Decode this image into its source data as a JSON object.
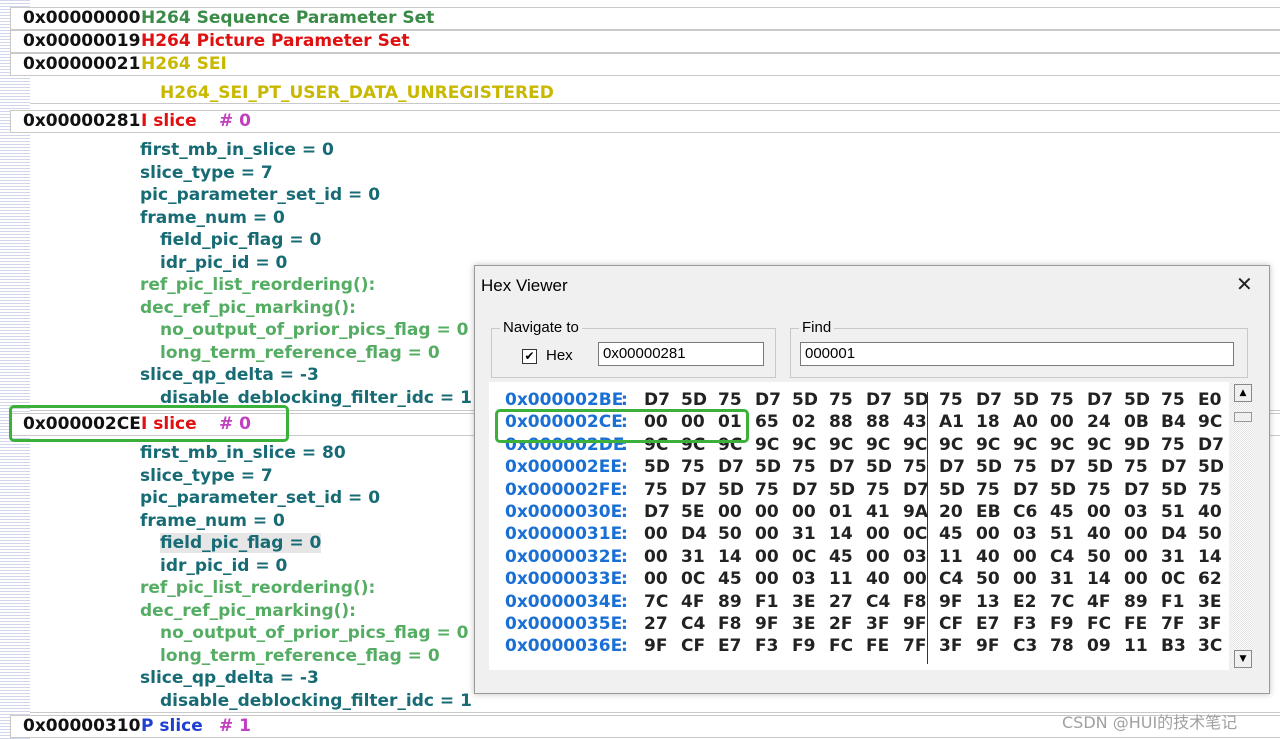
{
  "nal_units": [
    {
      "addr": "0x00000000",
      "name": "H264 Sequence Parameter Set",
      "name_color": "#3a8a48",
      "index": "",
      "index_color": ""
    },
    {
      "addr": "0x00000019",
      "name": "H264 Picture Parameter Set",
      "name_color": "#e01010",
      "index": "",
      "index_color": ""
    },
    {
      "addr": "0x00000021",
      "name": "H264 SEI",
      "name_color": "#c8b800",
      "index": "",
      "index_color": ""
    },
    {
      "addr": "0x00000281",
      "name": "I  slice",
      "name_color": "#e01010",
      "index": "# 0",
      "index_color": "#c040c0"
    },
    {
      "addr": "0x000002CE",
      "name": "I  slice",
      "name_color": "#e01010",
      "index": "# 0",
      "index_color": "#c040c0"
    },
    {
      "addr": "0x00000310",
      "name": "P slice",
      "name_color": "#1f3fd0",
      "index": "# 1",
      "index_color": "#c040c0"
    }
  ],
  "sei_detail": "H264_SEI_PT_USER_DATA_UNREGISTERED",
  "slice_fields": [
    [
      {
        "text": "first_mb_in_slice = 0",
        "color": "teal",
        "indent": 0
      },
      {
        "text": "slice_type = 7",
        "color": "teal",
        "indent": 0
      },
      {
        "text": "pic_parameter_set_id = 0",
        "color": "teal",
        "indent": 0
      },
      {
        "text": "frame_num = 0",
        "color": "teal",
        "indent": 0
      },
      {
        "text": "field_pic_flag = 0",
        "color": "teal",
        "indent": 1
      },
      {
        "text": "idr_pic_id = 0",
        "color": "teal",
        "indent": 1
      },
      {
        "text": "ref_pic_list_reordering():",
        "color": "green",
        "indent": 0
      },
      {
        "text": "dec_ref_pic_marking():",
        "color": "green",
        "indent": 0
      },
      {
        "text": "no_output_of_prior_pics_flag = 0",
        "color": "green",
        "indent": 1
      },
      {
        "text": "long_term_reference_flag = 0",
        "color": "green",
        "indent": 1
      },
      {
        "text": "slice_qp_delta = -3",
        "color": "teal",
        "indent": 0
      },
      {
        "text": "disable_deblocking_filter_idc = 1",
        "color": "teal",
        "indent": 1
      }
    ],
    [
      {
        "text": "first_mb_in_slice = 80",
        "color": "teal",
        "indent": 0
      },
      {
        "text": "slice_type = 7",
        "color": "teal",
        "indent": 0
      },
      {
        "text": "pic_parameter_set_id = 0",
        "color": "teal",
        "indent": 0
      },
      {
        "text": "frame_num = 0",
        "color": "teal",
        "indent": 0
      },
      {
        "text": "field_pic_flag = 0",
        "color": "teal",
        "indent": 1,
        "selected": true
      },
      {
        "text": "idr_pic_id = 0",
        "color": "teal",
        "indent": 1
      },
      {
        "text": "ref_pic_list_reordering():",
        "color": "green",
        "indent": 0
      },
      {
        "text": "dec_ref_pic_marking():",
        "color": "green",
        "indent": 0
      },
      {
        "text": "no_output_of_prior_pics_flag = 0",
        "color": "green",
        "indent": 1
      },
      {
        "text": "long_term_reference_flag = 0",
        "color": "green",
        "indent": 1
      },
      {
        "text": "slice_qp_delta = -3",
        "color": "teal",
        "indent": 0
      },
      {
        "text": "disable_deblocking_filter_idc = 1",
        "color": "teal",
        "indent": 1
      }
    ]
  ],
  "hex_viewer": {
    "title": "Hex Viewer",
    "close_icon": "close-icon",
    "navigate": {
      "legend": "Navigate to",
      "hex_label": "Hex",
      "hex_checked": true,
      "value": "0x00000281"
    },
    "find": {
      "legend": "Find",
      "value": "000001"
    },
    "rows": [
      {
        "addr": "0x000002BE",
        "bytes": [
          "D7",
          "5D",
          "75",
          "D7",
          "5D",
          "75",
          "D7",
          "5D",
          "75",
          "D7",
          "5D",
          "75",
          "D7",
          "5D",
          "75",
          "E0"
        ]
      },
      {
        "addr": "0x000002CE",
        "bytes": [
          "00",
          "00",
          "01",
          "65",
          "02",
          "88",
          "88",
          "43",
          "A1",
          "18",
          "A0",
          "00",
          "24",
          "0B",
          "B4",
          "9C"
        ]
      },
      {
        "addr": "0x000002DE",
        "bytes": [
          "9C",
          "9C",
          "9C",
          "9C",
          "9C",
          "9C",
          "9C",
          "9C",
          "9C",
          "9C",
          "9C",
          "9C",
          "9C",
          "9D",
          "75",
          "D7"
        ]
      },
      {
        "addr": "0x000002EE",
        "bytes": [
          "5D",
          "75",
          "D7",
          "5D",
          "75",
          "D7",
          "5D",
          "75",
          "D7",
          "5D",
          "75",
          "D7",
          "5D",
          "75",
          "D7",
          "5D"
        ]
      },
      {
        "addr": "0x000002FE",
        "bytes": [
          "75",
          "D7",
          "5D",
          "75",
          "D7",
          "5D",
          "75",
          "D7",
          "5D",
          "75",
          "D7",
          "5D",
          "75",
          "D7",
          "5D",
          "75"
        ]
      },
      {
        "addr": "0x0000030E",
        "bytes": [
          "D7",
          "5E",
          "00",
          "00",
          "00",
          "01",
          "41",
          "9A",
          "20",
          "EB",
          "C6",
          "45",
          "00",
          "03",
          "51",
          "40"
        ]
      },
      {
        "addr": "0x0000031E",
        "bytes": [
          "00",
          "D4",
          "50",
          "00",
          "31",
          "14",
          "00",
          "0C",
          "45",
          "00",
          "03",
          "51",
          "40",
          "00",
          "D4",
          "50"
        ]
      },
      {
        "addr": "0x0000032E",
        "bytes": [
          "00",
          "31",
          "14",
          "00",
          "0C",
          "45",
          "00",
          "03",
          "11",
          "40",
          "00",
          "C4",
          "50",
          "00",
          "31",
          "14"
        ]
      },
      {
        "addr": "0x0000033E",
        "bytes": [
          "00",
          "0C",
          "45",
          "00",
          "03",
          "11",
          "40",
          "00",
          "C4",
          "50",
          "00",
          "31",
          "14",
          "00",
          "0C",
          "62"
        ]
      },
      {
        "addr": "0x0000034E",
        "bytes": [
          "7C",
          "4F",
          "89",
          "F1",
          "3E",
          "27",
          "C4",
          "F8",
          "9F",
          "13",
          "E2",
          "7C",
          "4F",
          "89",
          "F1",
          "3E"
        ]
      },
      {
        "addr": "0x0000035E",
        "bytes": [
          "27",
          "C4",
          "F8",
          "9F",
          "3E",
          "2F",
          "3F",
          "9F",
          "CF",
          "E7",
          "F3",
          "F9",
          "FC",
          "FE",
          "7F",
          "3F"
        ]
      },
      {
        "addr": "0x0000036E",
        "bytes": [
          "9F",
          "CF",
          "E7",
          "F3",
          "F9",
          "FC",
          "FE",
          "7F",
          "3F",
          "9F",
          "C3",
          "78",
          "09",
          "11",
          "B3",
          "3C"
        ]
      }
    ],
    "scroll_up_icon": "scroll-up-arrow-icon",
    "scroll_down_icon": "scroll-down-arrow-icon"
  },
  "colors": {
    "teal": "#176b74",
    "green": "#55ad64",
    "hex_addr": "#1a6fd4",
    "highlight": "#3bb13b"
  },
  "watermark": "CSDN @HUI的技术笔记"
}
